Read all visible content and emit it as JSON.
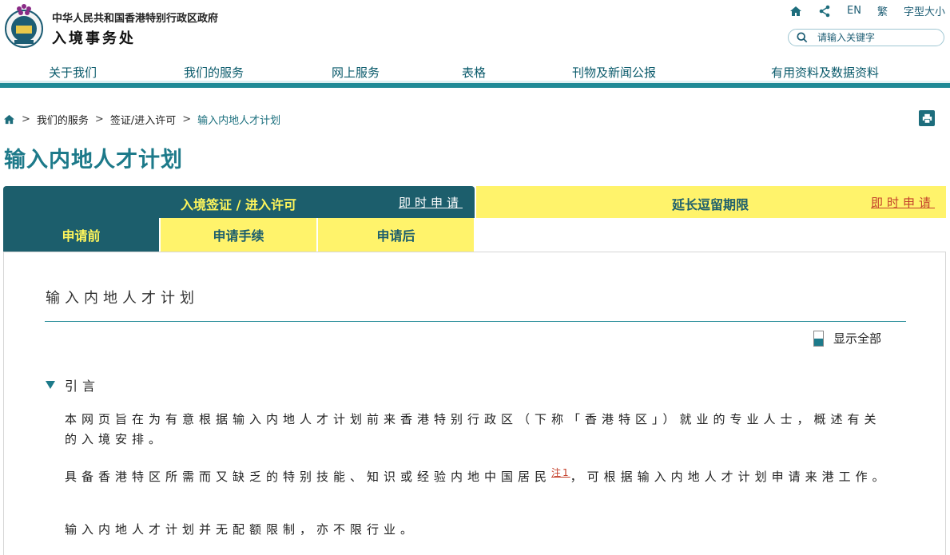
{
  "header": {
    "gov_name": "中华人民共和国香港特别行政区政府",
    "dept_name": "入境事务处",
    "top_links": {
      "english": "EN",
      "traditional": "繁",
      "font_size": "字型大小"
    },
    "search_placeholder": "请输入关键字"
  },
  "nav": {
    "items": [
      "关于我们",
      "我们的服务",
      "网上服务",
      "表格",
      "刊物及新闻公报",
      "有用资料及数据资料"
    ]
  },
  "breadcrumb": {
    "items": [
      "我们的服务",
      "签证/进入许可",
      "输入内地人才计划"
    ],
    "separator": ">"
  },
  "page_title": "输入内地人才计划",
  "tabs": {
    "main_left_label": "入境签证 / 进入许可",
    "main_left_link": "即时申请",
    "main_right_label": "延长逗留期限",
    "main_right_link": "即时申请",
    "subtabs": [
      "申请前",
      "申请手续",
      "申请后"
    ]
  },
  "content": {
    "section_title": "输入内地人才计划",
    "show_all": "显示全部",
    "intro_heading": "引言",
    "para1": "本网页旨在为有意根据输入内地人才计划前来香港特别行政区（下称「香港特区」）就业的专业人士，概述有关的入境安排。",
    "para2_before": "具备香港特区所需而又缺乏的特别技能、知识或经验内地中国居民",
    "para2_note": "注1",
    "para2_after": "，可根据输入内地人才计划申请来港工作。",
    "para3": "输入内地人才计划并无配额限制，亦不限行业。"
  },
  "colors": {
    "brand_teal": "#1c5e6c",
    "accent_yellow": "#fff36b",
    "title_teal": "#1d7a8a",
    "link_red": "#c4402b"
  }
}
